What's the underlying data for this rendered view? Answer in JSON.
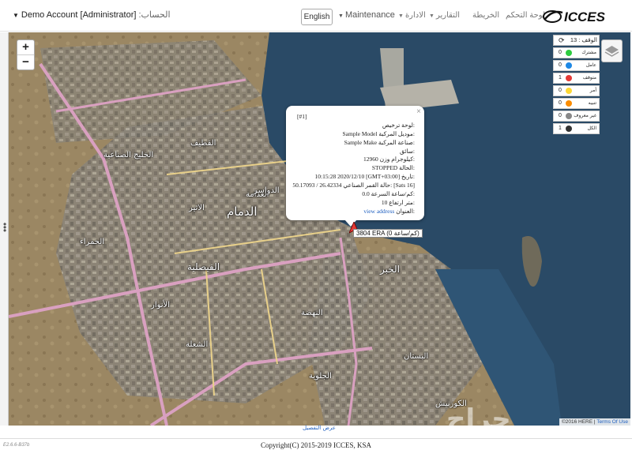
{
  "navbar": {
    "account_name": "Demo Account [Administrator]",
    "account_label": ":الحساب",
    "language_button": "English",
    "menu_maintenance": "Maintenance",
    "menu_admin": "الادارة",
    "menu_reports": "التقارير",
    "menu_map": "الخريطة",
    "menu_dashboard": "لوحة التحكم",
    "logo_text": "ICCES"
  },
  "map": {
    "zoom_in": "+",
    "zoom_out": "−",
    "places": {
      "dammam": "الدمام",
      "khobar": "الخبر",
      "qatif": "القطيف",
      "ramadan": "الاثير",
      "jalawiyah": "الجلوية",
      "corniche": "الكورنيش",
      "faisaliah": "الفيصلية",
      "adamah": "العدامة",
      "anwar": "الأنوار",
      "shula": "الشعلة",
      "ruwais": "الدواسر",
      "nahda": "النهضة",
      "bustan": "البستان",
      "hamra": "الحمراء",
      "khaleej": "الخليج الصناعية"
    }
  },
  "popup": {
    "close": "×",
    "id": "[#1]",
    "plate": "لوحة ترخيص:",
    "model_label": "موديل المركبة:",
    "model_value": "Sample Model",
    "make_label": "صناعة المركبة:",
    "make_value": "Sample Make",
    "driver": "سائق:",
    "weight_label": "وزن:",
    "weight_value": "12960 كيلوجرام",
    "status_label": "الحالة:",
    "status_value": "STOPPED",
    "date_label": "تاريخ:",
    "date_value": "10:15:28 2020/12/10 [GMT+03:00]",
    "coords_value": "50.17093 / 26.42334",
    "coords_label": "حالة القمر الصناعي:",
    "sats": "[Sats 16]",
    "speed_label": "السرعة:",
    "speed_value": "0.0 كم/ساعة",
    "altitude_label": "ارتفاع:",
    "altitude_value": "10 متر",
    "address_label": "العنوان:",
    "address_link": "view address"
  },
  "vehicle_label": "3804 ERA (0 كم/ساعة)",
  "status_panel": {
    "refresh": "⟳",
    "total_label": "الوقف : 13",
    "rows": [
      {
        "count": "0",
        "color": "#2ecc40",
        "label": "مشترك"
      },
      {
        "count": "0",
        "color": "#1e88e5",
        "label": "عامل"
      },
      {
        "count": "1",
        "color": "#e53935",
        "label": "متوقف"
      },
      {
        "count": "0",
        "color": "#fdd835",
        "label": "أمر"
      },
      {
        "count": "0",
        "color": "#fb8c00",
        "label": "تنبيه"
      },
      {
        "count": "0",
        "color": "#888888",
        "label": "غير معروف"
      },
      {
        "count": "1",
        "color": "#333333",
        "label": "الكل"
      }
    ]
  },
  "attribution": {
    "text": "©2016 HERE | ",
    "terms": "Terms Of Use"
  },
  "details_link": "عرض التفصيل",
  "version": "E2.6.6-B37b",
  "footer": "Copyright(C) 2015-2019 ICCES, KSA",
  "watermark": "حراج"
}
